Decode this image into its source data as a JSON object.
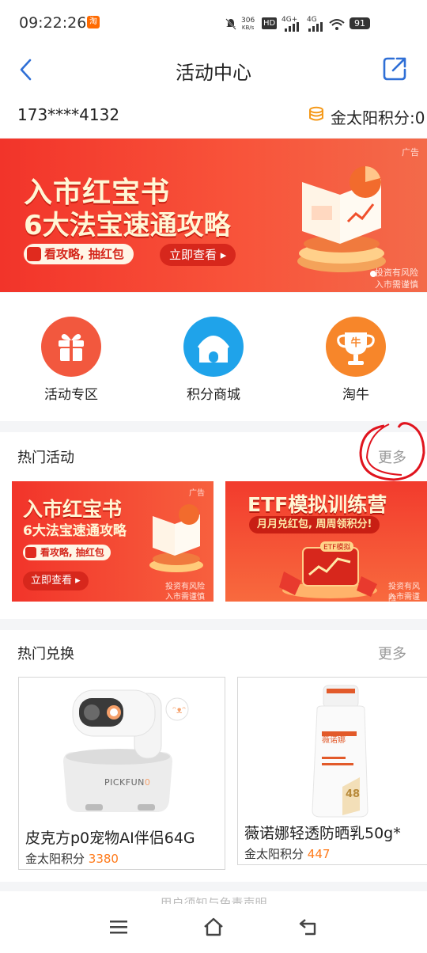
{
  "status_bar": {
    "time": "09:22:26",
    "app_badge": "淘",
    "net_speed_top": "306",
    "net_speed_bottom": "KB/s",
    "hd": "HD",
    "sim1": "4G+",
    "sim2": "4G",
    "battery": "91"
  },
  "header": {
    "title": "活动中心"
  },
  "account": {
    "phone": "173****4132",
    "points_text": "金太阳积分:0"
  },
  "banner": {
    "title_line1": "入市红宝书",
    "title_line2": "6大法宝速通攻略",
    "pill1": "看攻略, 抽红包",
    "pill2": "立即查看 ▸",
    "ad_label": "广告",
    "risk_line1": "投资有风险",
    "risk_line2": "入市需谨慎"
  },
  "nav_items": [
    {
      "label": "活动专区",
      "icon": "gift-icon",
      "color": "#f2583e"
    },
    {
      "label": "积分商城",
      "icon": "house-icon",
      "color": "#1fa3ea"
    },
    {
      "label": "淘牛",
      "icon": "trophy-icon",
      "color": "#f7862a",
      "badge": "牛"
    }
  ],
  "hot_activity": {
    "title": "热门活动",
    "more": "更多",
    "cards": [
      {
        "title_line1": "入市红宝书",
        "title_line2": "6大法宝速通攻略",
        "pill1": "看攻略, 抽红包",
        "pill2": "立即查看 ▸",
        "ad_label": "广告",
        "risk_line1": "投资有风险",
        "risk_line2": "入市需谨慎"
      },
      {
        "title": "ETF模拟训练营",
        "subtitle": "月月兑红包, 周周领积分!",
        "inner_label": "ETF模拟",
        "risk_line1": "投资有风险",
        "risk_line2": "入市需谨慎"
      }
    ]
  },
  "hot_exchange": {
    "title": "热门兑换",
    "more": "更多",
    "products": [
      {
        "name": "皮克方p0宠物AI伴侣64G",
        "points_label": "金太阳积分",
        "points": "3380",
        "brand": "PICKFUN",
        "brand_suffix": "0"
      },
      {
        "name": "薇诺娜轻透防晒乳50g*",
        "points_label": "金太阳积分",
        "points": "447",
        "bottle_label": "薇诺娜",
        "bottle_num": "48"
      }
    ]
  },
  "bottom_peek": "用户须知与免责声明",
  "colors": {
    "accent": "#f2342a",
    "points_orange": "#ff7a1a",
    "header_blue": "#2f6fd6"
  }
}
